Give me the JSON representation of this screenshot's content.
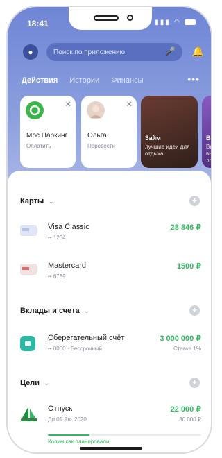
{
  "status": {
    "time": "18:41"
  },
  "search": {
    "placeholder": "Поиск по приложению"
  },
  "tabs": [
    {
      "label": "Действия",
      "active": true
    },
    {
      "label": "Истории",
      "active": false
    },
    {
      "label": "Финансы",
      "active": false
    }
  ],
  "actions": [
    {
      "title": "Мос Паркинг",
      "subtitle": "Оплатить"
    },
    {
      "title": "Ольга",
      "subtitle": "Перевести"
    }
  ],
  "promos": [
    {
      "title": "Займ",
      "subtitle": "лучшие идеи для отдыха"
    },
    {
      "title": "Вс",
      "subtitle": "Вы выиграли лото"
    }
  ],
  "sections": {
    "cards": {
      "title": "Карты"
    },
    "deposits": {
      "title": "Вклады и счета"
    },
    "goals": {
      "title": "Цели"
    }
  },
  "card_rows": [
    {
      "name": "Visa Classic",
      "number": "•• 1234",
      "amount": "28 846 ₽"
    },
    {
      "name": "Mastercard",
      "number": "•• 6789",
      "amount": "1500 ₽"
    }
  ],
  "deposit_rows": [
    {
      "name": "Сберегательный счёт",
      "number": "•• 0000 · Бессрочный",
      "amount": "3 000 000 ₽",
      "note": "Ставка 1%"
    }
  ],
  "goal_rows": [
    {
      "name": "Отпуск",
      "date": "До 01 Авг 2020",
      "amount": "22 000 ₽",
      "target": "80 000 ₽",
      "progress": 0.27,
      "caption": "Копим как планировали"
    }
  ],
  "colors": {
    "header": "#7489d8",
    "accent_green": "#35b863"
  },
  "icons": [
    "avatar-icon",
    "mic-icon",
    "bell-icon",
    "parking-icon",
    "plus-icon",
    "card-icon",
    "deposit-icon",
    "goal-boat-icon"
  ]
}
